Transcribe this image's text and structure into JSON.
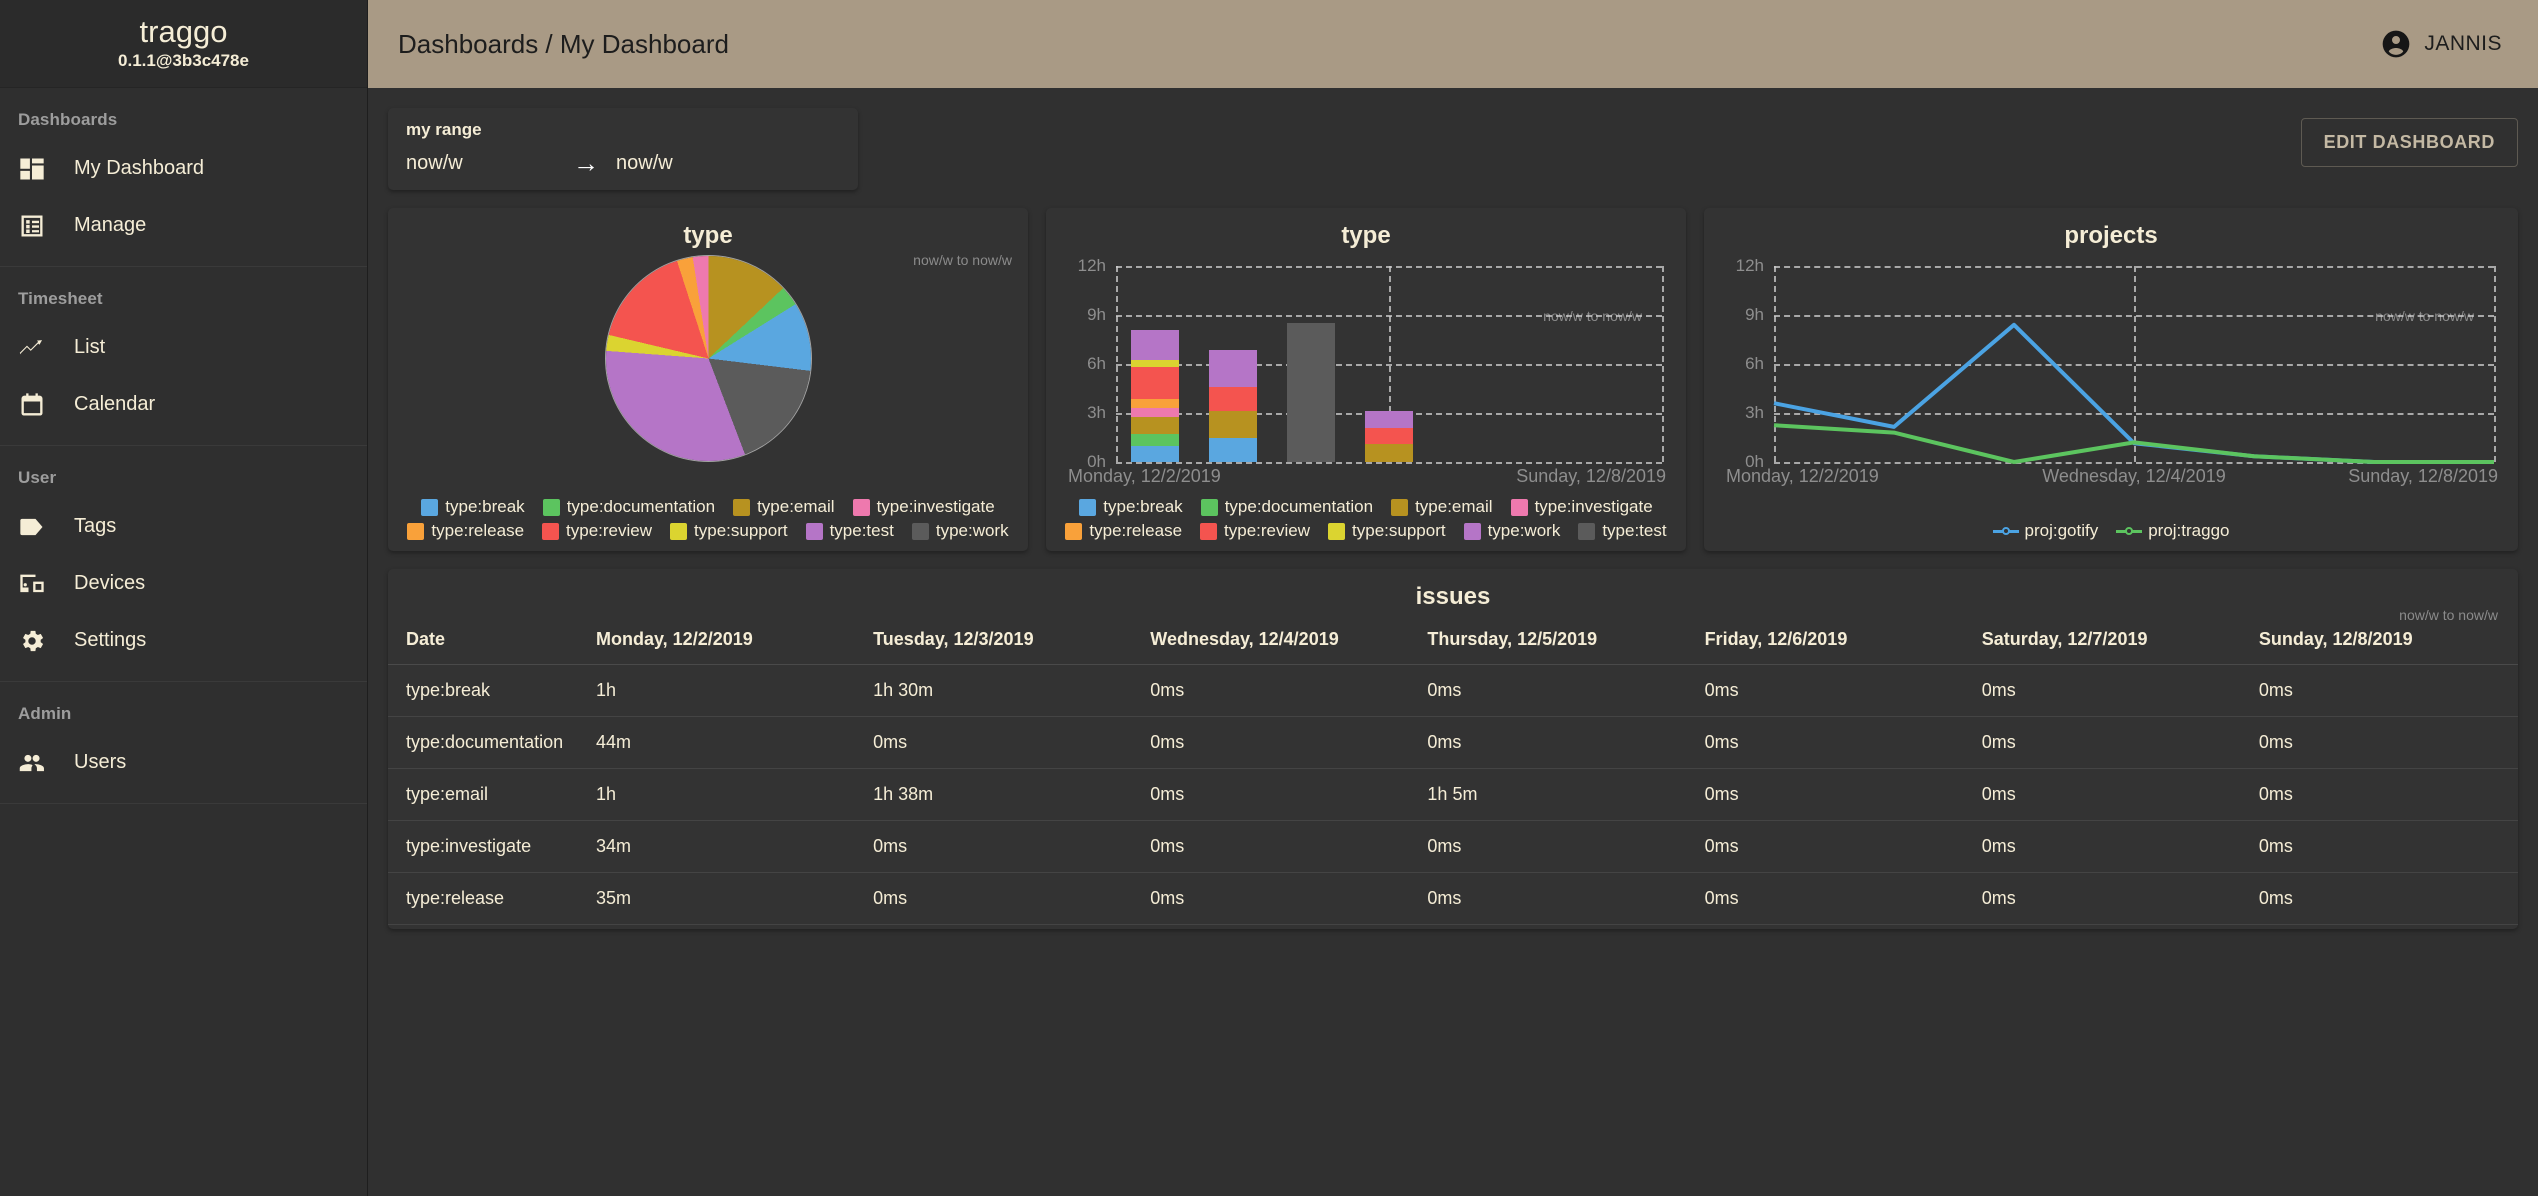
{
  "brand": {
    "title": "traggo",
    "version": "0.1.1@3b3c478e"
  },
  "sidebar": {
    "groups": [
      {
        "label": "Dashboards",
        "items": [
          {
            "label": "My Dashboard",
            "icon": "dashboard-icon"
          },
          {
            "label": "Manage",
            "icon": "manage-list-icon"
          }
        ]
      },
      {
        "label": "Timesheet",
        "items": [
          {
            "label": "List",
            "icon": "timeline-icon"
          },
          {
            "label": "Calendar",
            "icon": "calendar-icon"
          }
        ]
      },
      {
        "label": "User",
        "items": [
          {
            "label": "Tags",
            "icon": "tag-icon"
          },
          {
            "label": "Devices",
            "icon": "devices-icon"
          },
          {
            "label": "Settings",
            "icon": "gear-icon"
          }
        ]
      },
      {
        "label": "Admin",
        "items": [
          {
            "label": "Users",
            "icon": "users-icon"
          }
        ]
      }
    ]
  },
  "topbar": {
    "breadcrumb": "Dashboards / My Dashboard",
    "user_name": "JANNIS"
  },
  "range": {
    "title": "my range",
    "from": "now/w",
    "to": "now/w",
    "arrow": "→"
  },
  "actions": {
    "edit_dashboard": "EDIT DASHBOARD"
  },
  "colors": {
    "break": "#5aa7e0",
    "documentation": "#5cc45f",
    "email": "#b79220",
    "investigate": "#ee79ae",
    "release": "#f9a13a",
    "review": "#f4544f",
    "support": "#dbd430",
    "test": "#b575c7",
    "work": "#5b5b5b",
    "gotify": "#4ba3e3",
    "traggo": "#5cc45f",
    "accent": "#a99a85",
    "card_bg": "#333333"
  },
  "chart_data": [
    {
      "type": "pie",
      "title": "type",
      "range_label": "now/w to now/w",
      "categories": [
        "type:email",
        "type:documentation",
        "type:break",
        "type:work",
        "type:test",
        "type:support",
        "type:review",
        "type:release",
        "type:investigate"
      ],
      "values": [
        3.0,
        0.73,
        2.5,
        4.0,
        7.4,
        0.58,
        3.78,
        0.58,
        0.57
      ],
      "unit": "hours",
      "legend": [
        {
          "label": "type:break",
          "color": "#5aa7e0"
        },
        {
          "label": "type:documentation",
          "color": "#5cc45f"
        },
        {
          "label": "type:email",
          "color": "#b79220"
        },
        {
          "label": "type:investigate",
          "color": "#ee79ae"
        },
        {
          "label": "type:release",
          "color": "#f9a13a"
        },
        {
          "label": "type:review",
          "color": "#f4544f"
        },
        {
          "label": "type:support",
          "color": "#dbd430"
        },
        {
          "label": "type:test",
          "color": "#b575c7"
        },
        {
          "label": "type:work",
          "color": "#5b5b5b"
        }
      ],
      "legend_position": "bottom"
    },
    {
      "type": "bar",
      "stacked": true,
      "title": "type",
      "range_label": "now/w to now/w",
      "categories": [
        "Monday, 12/2/2019",
        "Tuesday, 12/3/2019",
        "Wednesday, 12/4/2019",
        "Thursday, 12/5/2019",
        "Friday, 12/6/2019",
        "Saturday, 12/7/2019",
        "Sunday, 12/8/2019"
      ],
      "xlabel_left": "Monday, 12/2/2019",
      "xlabel_right": "Sunday, 12/8/2019",
      "ylabel": "",
      "ylim": [
        0,
        12
      ],
      "yticks": [
        "0h",
        "3h",
        "6h",
        "9h",
        "12h"
      ],
      "grid": true,
      "series": [
        {
          "name": "type:break",
          "color": "#5aa7e0",
          "values": [
            1.0,
            1.5,
            0,
            0,
            0,
            0,
            0
          ]
        },
        {
          "name": "type:documentation",
          "color": "#5cc45f",
          "values": [
            0.73,
            0,
            0,
            0,
            0,
            0,
            0
          ]
        },
        {
          "name": "type:email",
          "color": "#b79220",
          "values": [
            1.0,
            1.63,
            0,
            1.08,
            0,
            0,
            0
          ]
        },
        {
          "name": "type:investigate",
          "color": "#ee79ae",
          "values": [
            0.57,
            0,
            0,
            0,
            0,
            0,
            0
          ]
        },
        {
          "name": "type:release",
          "color": "#f9a13a",
          "values": [
            0.58,
            0,
            0,
            0,
            0,
            0,
            0
          ]
        },
        {
          "name": "type:review",
          "color": "#f4544f",
          "values": [
            1.95,
            1.45,
            0,
            1.0,
            0,
            0,
            0
          ]
        },
        {
          "name": "type:support",
          "color": "#dbd430",
          "values": [
            0.42,
            0,
            0,
            0,
            0,
            0,
            0
          ]
        },
        {
          "name": "type:work",
          "color": "#b575c7",
          "values": [
            1.85,
            2.3,
            0,
            1.05,
            0,
            0,
            0
          ]
        },
        {
          "name": "type:test",
          "color": "#5b5b5b",
          "values": [
            0,
            0,
            8.5,
            0,
            0,
            0,
            0
          ]
        }
      ],
      "legend": [
        {
          "label": "type:break",
          "color": "#5aa7e0"
        },
        {
          "label": "type:documentation",
          "color": "#5cc45f"
        },
        {
          "label": "type:email",
          "color": "#b79220"
        },
        {
          "label": "type:investigate",
          "color": "#ee79ae"
        },
        {
          "label": "type:release",
          "color": "#f9a13a"
        },
        {
          "label": "type:review",
          "color": "#f4544f"
        },
        {
          "label": "type:support",
          "color": "#dbd430"
        },
        {
          "label": "type:work",
          "color": "#b575c7"
        },
        {
          "label": "type:test",
          "color": "#5b5b5b"
        }
      ],
      "legend_position": "bottom"
    },
    {
      "type": "line",
      "title": "projects",
      "range_label": "now/w to now/w",
      "categories": [
        "Monday, 12/2/2019",
        "Tuesday, 12/3/2019",
        "Wednesday, 12/4/2019",
        "Thursday, 12/5/2019",
        "Friday, 12/6/2019",
        "Saturday, 12/7/2019",
        "Sunday, 12/8/2019"
      ],
      "xlabel_left": "Monday, 12/2/2019",
      "xlabel_mid": "Wednesday, 12/4/2019",
      "xlabel_right": "Sunday, 12/8/2019",
      "ylim": [
        0,
        12
      ],
      "yticks": [
        "0h",
        "3h",
        "6h",
        "9h",
        "12h"
      ],
      "grid": true,
      "series": [
        {
          "name": "proj:gotify",
          "color": "#4ba3e3",
          "values": [
            3.6,
            2.15,
            8.4,
            1.15,
            0.35,
            0,
            0
          ]
        },
        {
          "name": "proj:traggo",
          "color": "#5cc45f",
          "values": [
            2.25,
            1.8,
            0.0,
            1.2,
            0.35,
            0,
            0
          ]
        }
      ],
      "legend": [
        {
          "label": "proj:gotify",
          "color": "#4ba3e3"
        },
        {
          "label": "proj:traggo",
          "color": "#5cc45f"
        }
      ],
      "legend_position": "bottom"
    },
    {
      "type": "table",
      "title": "issues",
      "range_label": "now/w to now/w",
      "columns": [
        "Date",
        "Monday, 12/2/2019",
        "Tuesday, 12/3/2019",
        "Wednesday, 12/4/2019",
        "Thursday, 12/5/2019",
        "Friday, 12/6/2019",
        "Saturday, 12/7/2019",
        "Sunday, 12/8/2019"
      ],
      "rows": [
        [
          "type:break",
          "1h",
          "1h 30m",
          "0ms",
          "0ms",
          "0ms",
          "0ms",
          "0ms"
        ],
        [
          "type:documentation",
          "44m",
          "0ms",
          "0ms",
          "0ms",
          "0ms",
          "0ms",
          "0ms"
        ],
        [
          "type:email",
          "1h",
          "1h 38m",
          "0ms",
          "1h 5m",
          "0ms",
          "0ms",
          "0ms"
        ],
        [
          "type:investigate",
          "34m",
          "0ms",
          "0ms",
          "0ms",
          "0ms",
          "0ms",
          "0ms"
        ],
        [
          "type:release",
          "35m",
          "0ms",
          "0ms",
          "0ms",
          "0ms",
          "0ms",
          "0ms"
        ]
      ]
    }
  ]
}
